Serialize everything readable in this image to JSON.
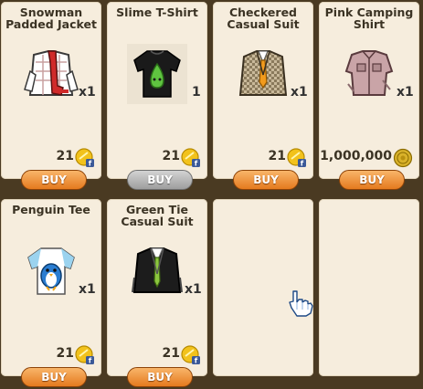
{
  "shop": {
    "buy_label": "BUY",
    "items": [
      {
        "name": "Snowman\nPadded Jacket",
        "qty": "x1",
        "price": "21",
        "currency": "fb-credit-coin",
        "buy_enabled": true
      },
      {
        "name": "Slime T-Shirt",
        "qty": "1",
        "price": "21",
        "currency": "fb-credit-coin",
        "buy_enabled": false
      },
      {
        "name": "Checkered\nCasual Suit",
        "qty": "x1",
        "price": "21",
        "currency": "fb-credit-coin",
        "buy_enabled": true
      },
      {
        "name": "Pink Camping\nShirt",
        "qty": "x1",
        "price": "1,000,000",
        "currency": "gold-coin",
        "buy_enabled": true
      },
      {
        "name": "Penguin Tee",
        "qty": "x1",
        "price": "21",
        "currency": "fb-credit-coin",
        "buy_enabled": true
      },
      {
        "name": "Green Tie\nCasual Suit",
        "qty": "x1",
        "price": "21",
        "currency": "fb-credit-coin",
        "buy_enabled": true
      }
    ]
  },
  "colors": {
    "background": "#4a3a22",
    "card": "#f6eddd",
    "buy_button": "#e57a1e",
    "buy_button_disabled": "#9e9e9e"
  }
}
